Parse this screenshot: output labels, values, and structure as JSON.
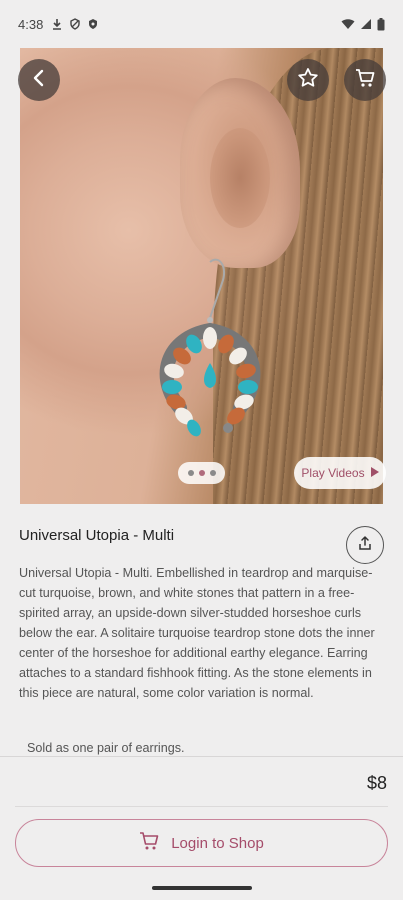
{
  "status_bar": {
    "time": "4:38",
    "left_icons": [
      "download-icon",
      "vpn-shield-icon",
      "security-icon"
    ],
    "right_icons": [
      "wifi-icon",
      "signal-icon",
      "battery-icon"
    ]
  },
  "hero": {
    "carousel_pages": 3,
    "carousel_active_index": 1,
    "play_videos_label": "Play Videos"
  },
  "product": {
    "title": "Universal Utopia - Multi",
    "description": "Universal Utopia - Multi. Embellished in teardrop and marquise-cut turquoise, brown, and white stones that pattern in a free-spirited array, an upside-down silver-studded horseshoe curls below the ear. A solitaire turquoise teardrop stone dots the inner center of the horseshoe for additional earthy elegance. Earring attaches to a standard fishhook fitting. As the stone elements in this piece are natural, some color variation is normal.",
    "note": "Sold as one pair of earrings.",
    "price": "$8"
  },
  "actions": {
    "login_label": "Login to Shop"
  },
  "colors": {
    "accent": "#a54c6a",
    "background": "#efeeee"
  }
}
